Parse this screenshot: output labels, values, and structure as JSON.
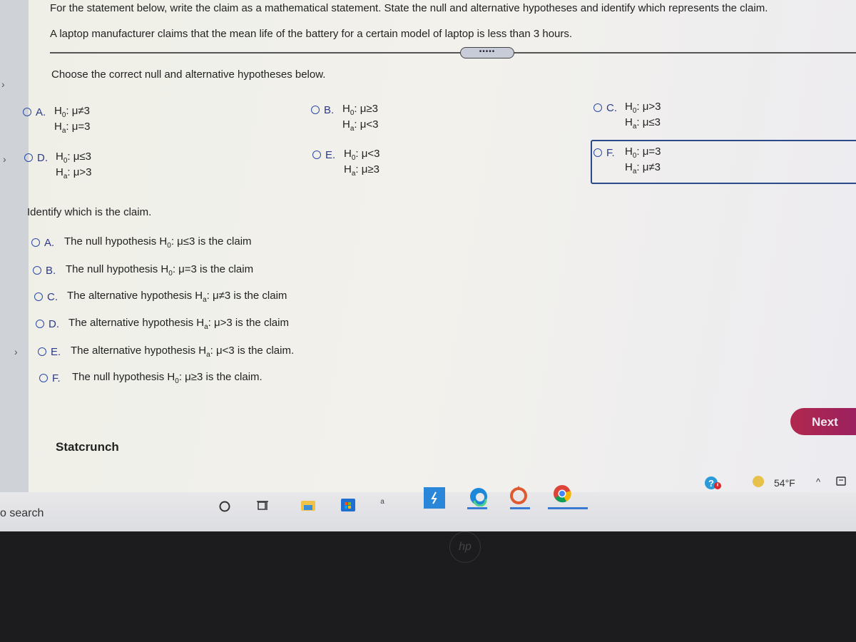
{
  "question": {
    "instructions": "For the statement below, write the claim as a mathematical statement. State the null and alternative hypotheses and identify which represents the claim.",
    "statement": "A laptop manufacturer claims that the mean life of the battery for a certain model of laptop is less than 3 hours.",
    "divider_handle": "•••••"
  },
  "part1": {
    "prompt": "Choose the correct null and alternative hypotheses below.",
    "selected": "F",
    "options": [
      {
        "letter": "A.",
        "h0": "μ≠3",
        "ha": "μ=3"
      },
      {
        "letter": "B.",
        "h0": "μ≥3",
        "ha": "μ<3"
      },
      {
        "letter": "C.",
        "h0": "μ>3",
        "ha": "μ≤3"
      },
      {
        "letter": "D.",
        "h0": "μ≤3",
        "ha": "μ>3"
      },
      {
        "letter": "E.",
        "h0": "μ<3",
        "ha": "μ≥3"
      },
      {
        "letter": "F.",
        "h0": "μ=3",
        "ha": "μ≠3"
      }
    ]
  },
  "part2": {
    "prompt": "Identify which is the claim.",
    "options": [
      {
        "letter": "A.",
        "pre": "The null hypothesis H",
        "sub": "0",
        "post": ": μ≤3 is the claim"
      },
      {
        "letter": "B.",
        "pre": "The null hypothesis H",
        "sub": "0",
        "post": ": μ=3 is the claim"
      },
      {
        "letter": "C.",
        "pre": "The alternative hypothesis H",
        "sub": "a",
        "post": ": μ≠3 is the claim"
      },
      {
        "letter": "D.",
        "pre": "The alternative hypothesis H",
        "sub": "a",
        "post": ": μ>3 is the claim"
      },
      {
        "letter": "E.",
        "pre": "The alternative hypothesis H",
        "sub": "a",
        "post": ": μ<3 is the claim."
      },
      {
        "letter": "F.",
        "pre": "The null hypothesis H",
        "sub": "0",
        "post": ": μ≥3 is the claim."
      }
    ]
  },
  "labels": {
    "h0": "H",
    "h0_sub": "0",
    "ha": "H",
    "ha_sub": "a",
    "colon": ": "
  },
  "buttons": {
    "next": "Next",
    "statcrunch": "Statcrunch"
  },
  "taskbar": {
    "search": "o search",
    "temperature": "54°F",
    "icons": [
      "cortana-icon",
      "task-view-icon",
      "file-explorer-icon",
      "store-icon",
      "app-icon",
      "azure-icon",
      "edge-icon",
      "origin-icon",
      "chrome-icon",
      "help-icon",
      "weather-icon",
      "chevron-up-icon",
      "notification-icon"
    ]
  },
  "bezel": {
    "logo": "hp"
  }
}
